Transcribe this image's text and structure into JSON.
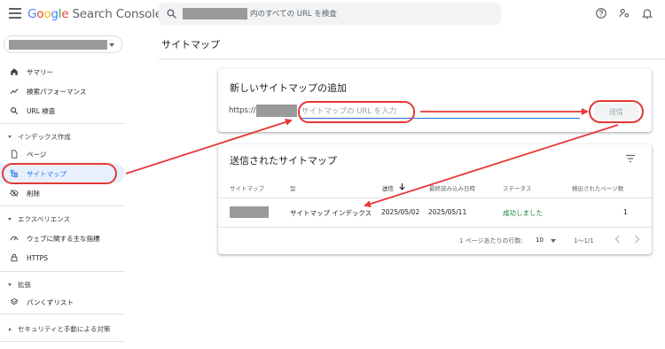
{
  "app": {
    "logo_google": [
      "G",
      "o",
      "o",
      "g",
      "l",
      "e"
    ],
    "product_name": "Search Console"
  },
  "search": {
    "placeholder": "内のすべての URL を検査"
  },
  "topbar_icons": [
    "help-icon",
    "manage-users-icon",
    "notifications-icon"
  ],
  "sidebar": {
    "summary": "サマリー",
    "performance": "検索パフォーマンス",
    "url_inspection": "URL 検査",
    "section_index": "インデックス作成",
    "pages": "ページ",
    "sitemaps": "サイトマップ",
    "removals": "削除",
    "section_experience": "エクスペリエンス",
    "core_web_vitals": "ウェブに関する主な指標",
    "https": "HTTPS",
    "section_enhancements": "拡張",
    "breadcrumbs": "パンくずリスト",
    "section_security": "セキュリティと手動による対策"
  },
  "main": {
    "page_title": "サイトマップ",
    "add_card": {
      "title": "新しいサイトマップの追加",
      "url_prefix": "https://",
      "input_placeholder": "サイトマップの URL を入力",
      "submit_label": "送信"
    },
    "submitted_card": {
      "title": "送信されたサイトマップ",
      "columns": {
        "sitemap": "サイトマップ",
        "type": "型",
        "submitted": "送信",
        "last_read": "最終読み込み日時",
        "status": "ステータス",
        "discovered_pages": "検出されたページ数"
      },
      "rows": [
        {
          "type": "サイトマップ インデックス",
          "submitted": "2025/05/02",
          "last_read": "2025/05/11",
          "status": "成功しました",
          "discovered_pages": "1"
        }
      ],
      "footer": {
        "rows_per_page_label": "1 ページあたりの行数:",
        "rows_per_page_value": "10",
        "range": "1〜1/1"
      }
    }
  },
  "colors": {
    "accent": "#1a73e8",
    "annotation_red": "#e53935",
    "success": "#188038",
    "active_bg": "#e8f0fe"
  }
}
